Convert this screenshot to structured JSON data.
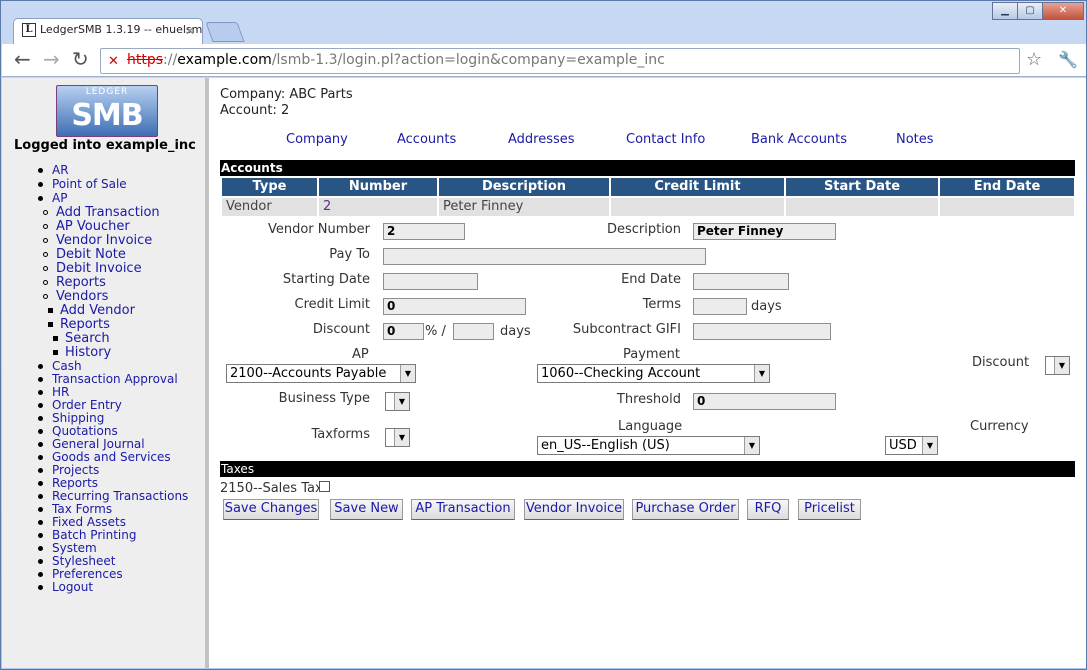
{
  "browser": {
    "tab_title": "LedgerSMB 1.3.19 -- ehuelsm",
    "favicon_letter": "L",
    "url_scheme": "https",
    "url_host": "example.com",
    "url_path": "/lsmb-1.3/login.pl?action=login&company=example_inc",
    "url_sep": "://"
  },
  "sidebar": {
    "logo_top": "LEDGER",
    "logo_main": "SMB",
    "logged_in": "Logged into example_inc",
    "menu": [
      {
        "label": "AR",
        "level": 0
      },
      {
        "label": "Point of Sale",
        "level": 0
      },
      {
        "label": "AP",
        "level": 0
      },
      {
        "label": "Add Transaction",
        "level": 1
      },
      {
        "label": "AP Voucher",
        "level": 1
      },
      {
        "label": "Vendor Invoice",
        "level": 1
      },
      {
        "label": "Debit Note",
        "level": 1
      },
      {
        "label": "Debit Invoice",
        "level": 1
      },
      {
        "label": "Reports",
        "level": 1
      },
      {
        "label": "Vendors",
        "level": 1
      },
      {
        "label": "Add Vendor",
        "level": 2
      },
      {
        "label": "Reports",
        "level": 2
      },
      {
        "label": "Search",
        "level": 3
      },
      {
        "label": "History",
        "level": 3
      },
      {
        "label": "Cash",
        "level": 0
      },
      {
        "label": "Transaction Approval",
        "level": 0
      },
      {
        "label": "HR",
        "level": 0
      },
      {
        "label": "Order Entry",
        "level": 0
      },
      {
        "label": "Shipping",
        "level": 0
      },
      {
        "label": "Quotations",
        "level": 0
      },
      {
        "label": "General Journal",
        "level": 0
      },
      {
        "label": "Goods and Services",
        "level": 0
      },
      {
        "label": "Projects",
        "level": 0
      },
      {
        "label": "Reports",
        "level": 0
      },
      {
        "label": "Recurring Transactions",
        "level": 0
      },
      {
        "label": "Tax Forms",
        "level": 0
      },
      {
        "label": "Fixed Assets",
        "level": 0
      },
      {
        "label": "Batch Printing",
        "level": 0
      },
      {
        "label": "System",
        "level": 0
      },
      {
        "label": "Stylesheet",
        "level": 0
      },
      {
        "label": "Preferences",
        "level": 0
      },
      {
        "label": "Logout",
        "level": 0
      }
    ]
  },
  "header": {
    "company": "Company: ABC Parts",
    "account": "Account: 2"
  },
  "tabs": [
    "Company",
    "Accounts",
    "Addresses",
    "Contact Info",
    "Bank Accounts",
    "Notes"
  ],
  "accounts": {
    "section_title": "Accounts",
    "columns": [
      "Type",
      "Number",
      "Description",
      "Credit Limit",
      "Start Date",
      "End Date"
    ],
    "row": [
      "Vendor",
      "2",
      "Peter Finney",
      "",
      "",
      ""
    ]
  },
  "form": {
    "vendor_number_label": "Vendor Number",
    "vendor_number": "2",
    "description_label": "Description",
    "description": "Peter Finney",
    "pay_to_label": "Pay To",
    "pay_to": "",
    "starting_date_label": "Starting Date",
    "starting_date": "",
    "end_date_label": "End Date",
    "end_date": "",
    "credit_limit_label": "Credit Limit",
    "credit_limit": "0",
    "terms_label": "Terms",
    "terms": "",
    "days": "days",
    "discount_label": "Discount",
    "discount": "0",
    "percent_sep": "% /",
    "discount_days": "",
    "subcontract_label": "Subcontract GIFI",
    "subcontract": "",
    "ap_label": "AP",
    "ap_value": "2100--Accounts Payable",
    "payment_label": "Payment",
    "payment_value": "1060--Checking Account",
    "discount2_label": "Discount",
    "discount2_value": "",
    "business_type_label": "Business Type",
    "business_type_value": "",
    "threshold_label": "Threshold",
    "threshold": "0",
    "taxforms_label": "Taxforms",
    "taxforms_value": "",
    "language_label": "Language",
    "language_value": "en_US--English (US)",
    "currency_label": "Currency",
    "currency_value": "USD"
  },
  "taxes": {
    "section_title": "Taxes",
    "item": "2150--Sales Tax"
  },
  "buttons": [
    "Save Changes",
    "Save New",
    "AP Transaction",
    "Vendor Invoice",
    "Purchase Order",
    "RFQ",
    "Pricelist"
  ]
}
